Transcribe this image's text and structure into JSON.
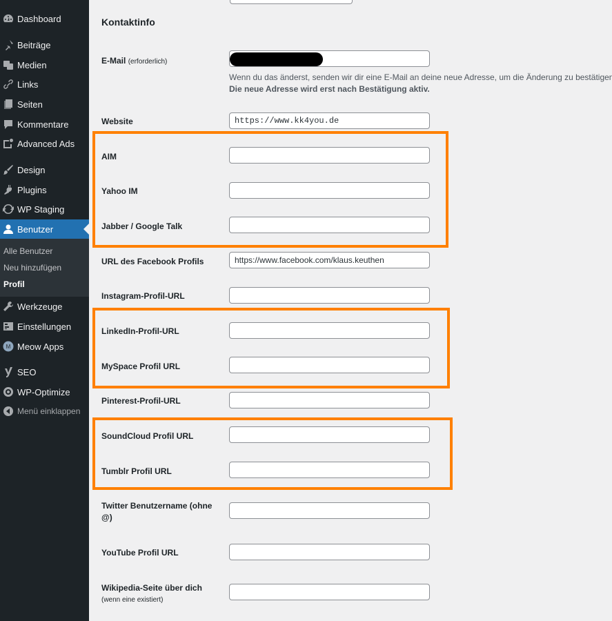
{
  "sidebar": {
    "items": [
      {
        "label": "Dashboard",
        "icon": "dashboard-icon"
      },
      {
        "label": "Beiträge",
        "icon": "pin-icon"
      },
      {
        "label": "Medien",
        "icon": "media-icon"
      },
      {
        "label": "Links",
        "icon": "link-icon"
      },
      {
        "label": "Seiten",
        "icon": "pages-icon"
      },
      {
        "label": "Kommentare",
        "icon": "comment-icon"
      },
      {
        "label": "Advanced Ads",
        "icon": "advanced-ads-icon"
      },
      {
        "label": "Design",
        "icon": "brush-icon"
      },
      {
        "label": "Plugins",
        "icon": "plug-icon"
      },
      {
        "label": "WP Staging",
        "icon": "staging-icon"
      },
      {
        "label": "Benutzer",
        "icon": "user-icon"
      },
      {
        "label": "Werkzeuge",
        "icon": "wrench-icon"
      },
      {
        "label": "Einstellungen",
        "icon": "settings-icon"
      },
      {
        "label": "Meow Apps",
        "icon": "meow-icon"
      },
      {
        "label": "SEO",
        "icon": "yoast-icon"
      },
      {
        "label": "WP-Optimize",
        "icon": "optimize-icon"
      }
    ],
    "submenu": [
      "Alle Benutzer",
      "Neu hinzufügen",
      "Profil"
    ],
    "collapse_label": "Menü einklappen"
  },
  "main": {
    "section_title": "Kontaktinfo",
    "email": {
      "label": "E-Mail",
      "label_note": "(erforderlich)",
      "description_line1": "Wenn du das änderst, senden wir dir eine E-Mail an deine neue Adresse, um die Änderung zu bestätigen.",
      "description_line2": "Die neue Adresse wird erst nach Bestätigung aktiv."
    },
    "website": {
      "label": "Website",
      "value": "https://www.kk4you.de"
    },
    "aim": {
      "label": "AIM",
      "value": ""
    },
    "yahoo": {
      "label": "Yahoo IM",
      "value": ""
    },
    "jabber": {
      "label": "Jabber / Google Talk",
      "value": ""
    },
    "facebook": {
      "label": "URL des Facebook Profils",
      "value": "https://www.facebook.com/klaus.keuthen"
    },
    "instagram": {
      "label": "Instagram-Profil-URL",
      "value": ""
    },
    "linkedin": {
      "label": "LinkedIn-Profil-URL",
      "value": ""
    },
    "myspace": {
      "label": "MySpace Profil URL",
      "value": ""
    },
    "pinterest": {
      "label": "Pinterest-Profil-URL",
      "value": ""
    },
    "soundcloud": {
      "label": "SoundCloud Profil URL",
      "value": ""
    },
    "tumblr": {
      "label": "Tumblr Profil URL",
      "value": ""
    },
    "twitter": {
      "label_line1": "Twitter Benutzername (ohne",
      "label_line2": "@)",
      "value": ""
    },
    "youtube": {
      "label": "YouTube Profil URL",
      "value": ""
    },
    "wikipedia": {
      "label": "Wikipedia-Seite über dich",
      "label_note": "(wenn eine existiert)",
      "value": ""
    }
  },
  "colors": {
    "highlight": "#ff8000",
    "sidebar_bg": "#1d2327",
    "active_bg": "#2271b1"
  }
}
